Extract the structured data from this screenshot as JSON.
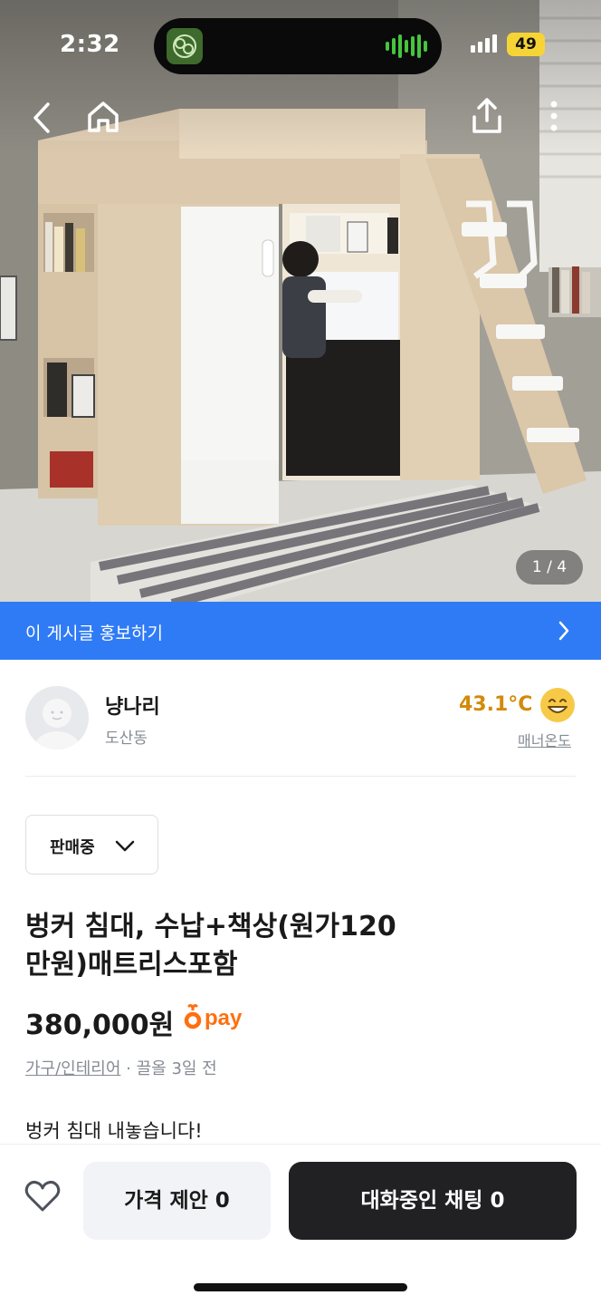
{
  "status_bar": {
    "time": "2:32",
    "battery": "49"
  },
  "photo": {
    "counter": "1 / 4"
  },
  "promote_bar": {
    "label": "이 게시글 홍보하기"
  },
  "seller": {
    "name": "냥나리",
    "location": "도산동",
    "manner_temp": "43.1°C",
    "manner_label": "매너온도"
  },
  "listing": {
    "status": "판매중",
    "title_line1": "벙커 침대, 수납+책상(원가120",
    "title_line2": "만원)매트리스포함",
    "price": "380,000원",
    "pay_label": "pay",
    "category": "가구/인테리어",
    "separator": " · ",
    "time": "끌올 3일 전",
    "description": "벙커 침대 내놓습니다!"
  },
  "actions": {
    "offer_button": "가격 제안 0",
    "chat_button": "대화중인 채팅 0"
  },
  "colors": {
    "promote_blue": "#2f7bf5",
    "temperature_orange": "#d38a0a",
    "pay_orange": "#ff6f0f",
    "dark_button": "#212124"
  },
  "icons": [
    "back-arrow-icon",
    "home-icon",
    "share-icon",
    "more-icon",
    "chevron-right-icon",
    "chevron-down-icon",
    "smiley-face-icon",
    "heart-icon",
    "carrot-icon"
  ]
}
